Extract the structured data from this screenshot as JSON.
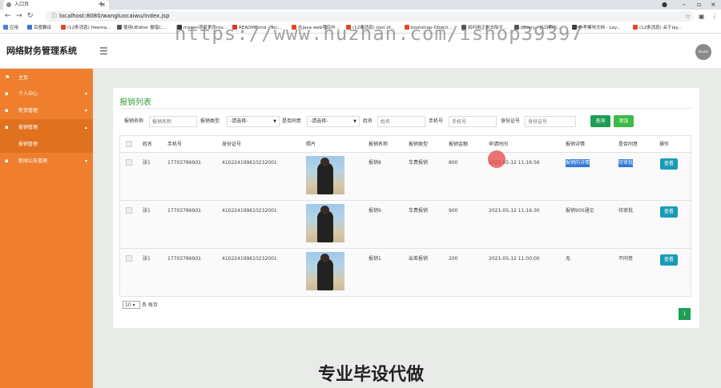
{
  "browser": {
    "tab_title": "入口页",
    "url": "localhost:8080/wangluocaiwu/index.jsp",
    "bookmarks": [
      "应用",
      "百度翻译",
      "(12条消息) freema...",
      "使用UEditor 报错C...",
      "maven项目更改roo...",
      "README.md - Tec...",
      "在java web项目中...",
      "(12条消息) root of...",
      "bootstrap-Object...",
      "如何用正则去除文...",
      "jQuery - JS日期与...",
      "参考模块文档 - Lay...",
      "(12条消息) 关于lay..."
    ],
    "watermark": "https://www.huzhan.com/ishop39397"
  },
  "app": {
    "title": "网络财务管理系统",
    "avatar_text": "Avatar"
  },
  "sidebar": {
    "items": [
      {
        "label": "主页",
        "icon": "flag-icon"
      },
      {
        "label": "个人中心",
        "icon": "user-icon"
      },
      {
        "label": "新资管理",
        "icon": "gear-icon"
      },
      {
        "label": "报销管理",
        "icon": "menu-icon"
      },
      {
        "label": "报销管理",
        "icon": ""
      },
      {
        "label": "新闻公告管理",
        "icon": "news-icon"
      }
    ]
  },
  "main": {
    "card_title": "报销列表",
    "filters": {
      "name_label": "报销名称",
      "name_placeholder": "报销名称",
      "type_label": "报销类型",
      "type_value": "-请选择-",
      "agree_label": "是否同意",
      "agree_value": "-请选择-",
      "person_label": "姓名",
      "person_placeholder": "姓名",
      "phone_label": "手机号",
      "phone_placeholder": "手机号",
      "id_label": "身份证号",
      "id_placeholder": "身份证号",
      "query_btn": "查询",
      "add_btn": "添加"
    },
    "table": {
      "headers": [
        "姓名",
        "手机号",
        "身份证号",
        "照片",
        "报销名称",
        "报销类型",
        "报销金额",
        "申请时间",
        "报销详情",
        "是否同意",
        "操作"
      ],
      "rows": [
        {
          "name": "张1",
          "phone": "17703786901",
          "id": "410224199610232001",
          "title": "报销8",
          "type": "车费报销",
          "amount": "800",
          "time": "2021-05-12 11:16:56",
          "detail": "报销的详情",
          "agree": "待审批",
          "action": "查看"
        },
        {
          "name": "张1",
          "phone": "17703786901",
          "id": "410224199610232001",
          "title": "报销9",
          "type": "车费报销",
          "amount": "900",
          "time": "2021-05-12 11:16:30",
          "detail": "报销900通见",
          "agree": "待审批",
          "action": "查看"
        },
        {
          "name": "张1",
          "phone": "17703786901",
          "id": "410224199610232001",
          "title": "报销1",
          "type": "出差报销",
          "amount": "200",
          "time": "2021-05-12 11:00:00",
          "detail": "无",
          "agree": "不同意",
          "action": "查看"
        }
      ]
    },
    "pager": {
      "page_size": "10",
      "per_page_label": "条 每页",
      "current_page": "1"
    },
    "promo": "专业毕设代做"
  }
}
